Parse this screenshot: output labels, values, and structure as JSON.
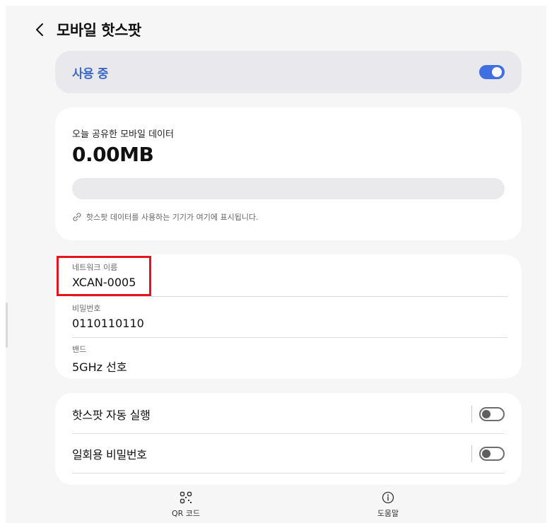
{
  "header": {
    "title": "모바일 핫스팟",
    "back_icon": "chevron-left-icon"
  },
  "status": {
    "label": "사용 중",
    "toggle_on": true,
    "accent": "#3f6fe0",
    "label_color": "#3b68c4"
  },
  "data_usage": {
    "label": "오늘 공유한 모바일 데이터",
    "value": "0.00MB",
    "progress": 0,
    "hint": "핫스팟 데이터를 사용하는 기기가 여기에 표시됩니다.",
    "hint_icon": "link-icon"
  },
  "network": {
    "name_label": "네트워크 이름",
    "name_value": "XCAN-0005",
    "password_label": "비밀번호",
    "password_value": "0110110110",
    "band_label": "밴드",
    "band_value": "5GHz 선호",
    "highlight_color": "#e3141c"
  },
  "settings": [
    {
      "label": "핫스팟 자동 실행",
      "on": false
    },
    {
      "label": "일회용 비밀번호",
      "on": false
    }
  ],
  "bottom_bar": {
    "qr": {
      "label": "QR 코드",
      "icon": "qr-code-icon"
    },
    "help": {
      "label": "도움말",
      "icon": "info-icon"
    }
  }
}
